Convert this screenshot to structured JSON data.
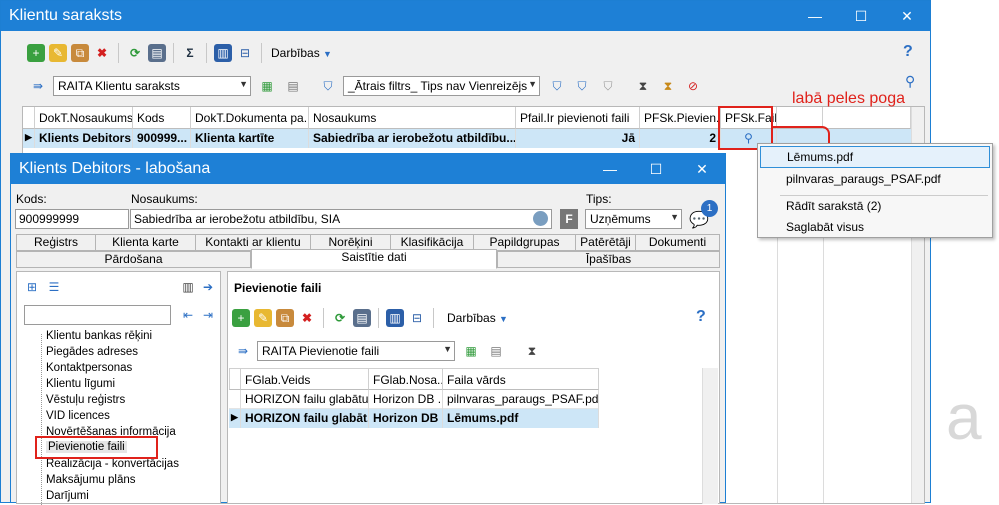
{
  "main_window": {
    "title": "Klientu saraksts",
    "actions_label": "Darbības",
    "report_combo": "RAITA Klientu saraksts",
    "filter_combo": "_Ātrais filtrs_ Tips nav Vienreizējs",
    "columns": [
      "DokT.Nosaukums",
      "Kods",
      "DokT.Dokumenta pa...",
      "Nosaukums",
      "Pfail.Ir pievienoti faili",
      "PFSk.Pievien...",
      "PFSk.Fails"
    ],
    "row": [
      "Klients Debitors",
      "900999...",
      "Klienta kartīte",
      "Sabiedrība ar ierobežotu atbildību...",
      "Jā",
      "2"
    ]
  },
  "annotation": "labā peles poga",
  "context_menu": {
    "items": [
      "Lēmums.pdf",
      "pilnvaras_paraugs_PSAF.pdf",
      "Rādīt sarakstā (2)",
      "Saglabāt visus"
    ]
  },
  "edit_window": {
    "title": "Klients Debitors - labošana",
    "kods_label": "Kods:",
    "kods_value": "900999999",
    "nosaukums_label": "Nosaukums:",
    "nosaukums_value": "Sabiedrība ar ierobežotu atbildību, SIA",
    "tips_label": "Tips:",
    "tips_value": "Uzņēmums",
    "f_button": "F",
    "badge": "1",
    "tabs_row1": [
      "Reģistrs",
      "Klienta karte",
      "Kontakti ar klientu",
      "Norēķini",
      "Klasifikācija",
      "Papildgrupas",
      "Patērētāji",
      "Dokumenti"
    ],
    "tabs_row2": [
      "Pārdošana",
      "Saistītie dati",
      "Īpašības"
    ],
    "tree_items": [
      "Klientu bankas rēķini",
      "Piegādes adreses",
      "Kontaktpersonas",
      "Klientu līgumi",
      "Vēstuļu reģistrs",
      "VID licences",
      "Novērtēšanas informācija",
      "Pievienotie faili",
      "Realizācija - konvertācijas",
      "Maksājumu plāns",
      "Darījumi"
    ],
    "panel_title": "Pievienotie faili",
    "actions_label": "Darbības",
    "files_combo": "RAITA Pievienotie faili",
    "file_columns": [
      "FGlab.Veids",
      "FGlab.Nosa...",
      "Faila vārds"
    ],
    "file_rows": [
      [
        "HORIZON failu glabātuve",
        "Horizon DB ...",
        "pilnvaras_paraugs_PSAF.pdf"
      ],
      [
        "HORIZON failu glabāt...",
        "Horizon DB ...",
        "Lēmums.pdf"
      ]
    ]
  },
  "colors": {
    "titlebar": "#1e80d6",
    "highlight": "#cde6f7",
    "annotation_red": "#e0221b"
  }
}
